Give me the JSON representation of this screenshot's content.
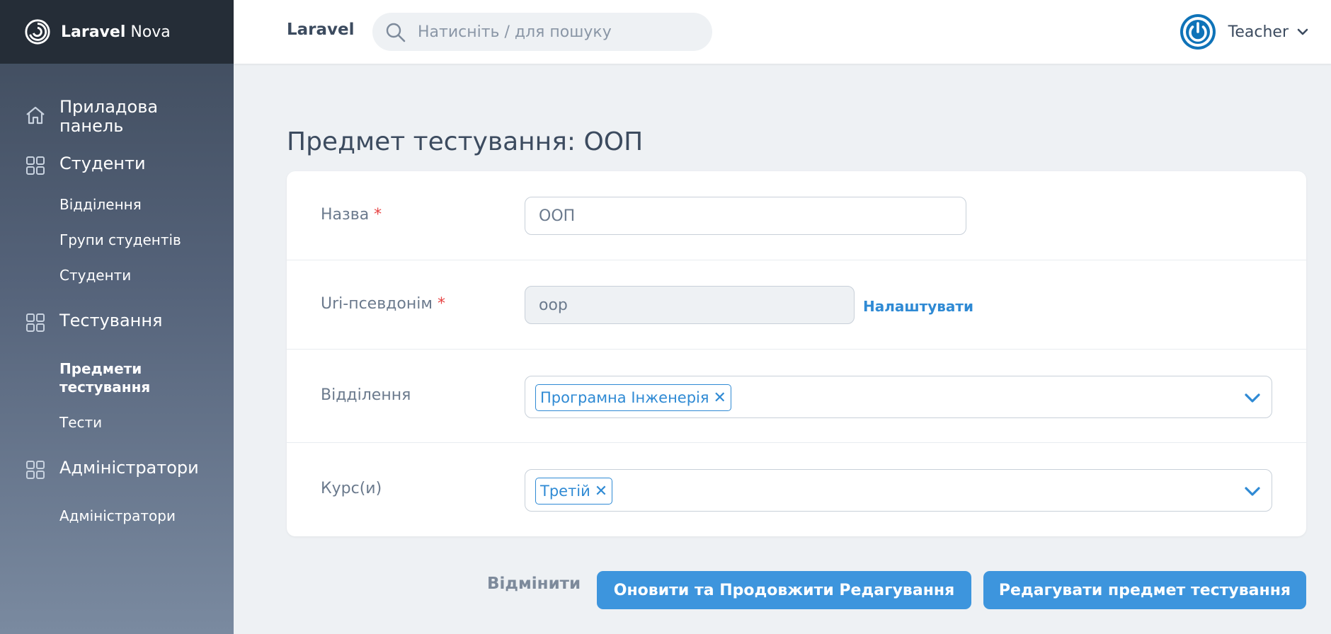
{
  "brand": {
    "name_bold": "Laravel",
    "name_light": "Nova",
    "logo_icon": "nova-swirl-icon"
  },
  "sidebar": {
    "dashboard": {
      "label": "Приладова панель",
      "icon": "home-icon"
    },
    "sections": [
      {
        "label": "Студенти",
        "icon": "grid-icon",
        "items": [
          "Відділення",
          "Групи студентів",
          "Студенти"
        ]
      },
      {
        "label": "Тестування",
        "icon": "grid-icon",
        "items": [
          "Предмети тестування",
          "Тести"
        ],
        "active_item": "Предмети тестування"
      },
      {
        "label": "Адміністратори",
        "icon": "grid-icon",
        "items": [
          "Адміністратори"
        ]
      }
    ]
  },
  "header": {
    "app_name": "Laravel",
    "search_placeholder": "Натисніть / для пошуку",
    "user_name": "Teacher"
  },
  "page": {
    "title": "Предмет тестування: ООП"
  },
  "form": {
    "name": {
      "label": "Назва",
      "required": "*",
      "value": "ООП"
    },
    "slug": {
      "label": "Uri-псевдонім",
      "required": "*",
      "value": "oop",
      "customize_label": "Налаштувати"
    },
    "departments": {
      "label": "Відділення",
      "selected": [
        "Програмна Інженерія"
      ]
    },
    "courses": {
      "label": "Курс(и)",
      "selected": [
        "Третій"
      ]
    }
  },
  "actions": {
    "cancel_label": "Відмінити",
    "update_continue_label": "Оновити та Продовжити Редагування",
    "update_label": "Редагувати предмет тестування"
  },
  "colors": {
    "accent": "#3d95dd",
    "sidebar_top": "#252d37",
    "avatar": "#0f73b8"
  }
}
